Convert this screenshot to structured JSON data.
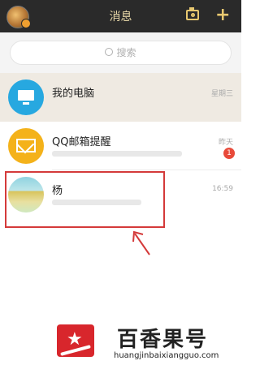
{
  "header": {
    "title": "消息",
    "camera_icon": "camera-icon",
    "add_icon": "plus-icon"
  },
  "search": {
    "placeholder": "搜索"
  },
  "conversations": [
    {
      "name": "我的电脑",
      "time": "星期三",
      "icon": "computer-icon"
    },
    {
      "name": "QQ邮箱提醒",
      "time": "昨天",
      "badge": "1",
      "icon": "mail-icon"
    },
    {
      "name": "杨",
      "time": "16:59",
      "icon": "avatar"
    }
  ],
  "watermark": {
    "brand": "百香果号",
    "url": "huangjinbaixiangguo.com"
  },
  "colors": {
    "header_bg": "#2a2a2a",
    "accent": "#e8c870",
    "highlight_border": "#d43a3a"
  }
}
